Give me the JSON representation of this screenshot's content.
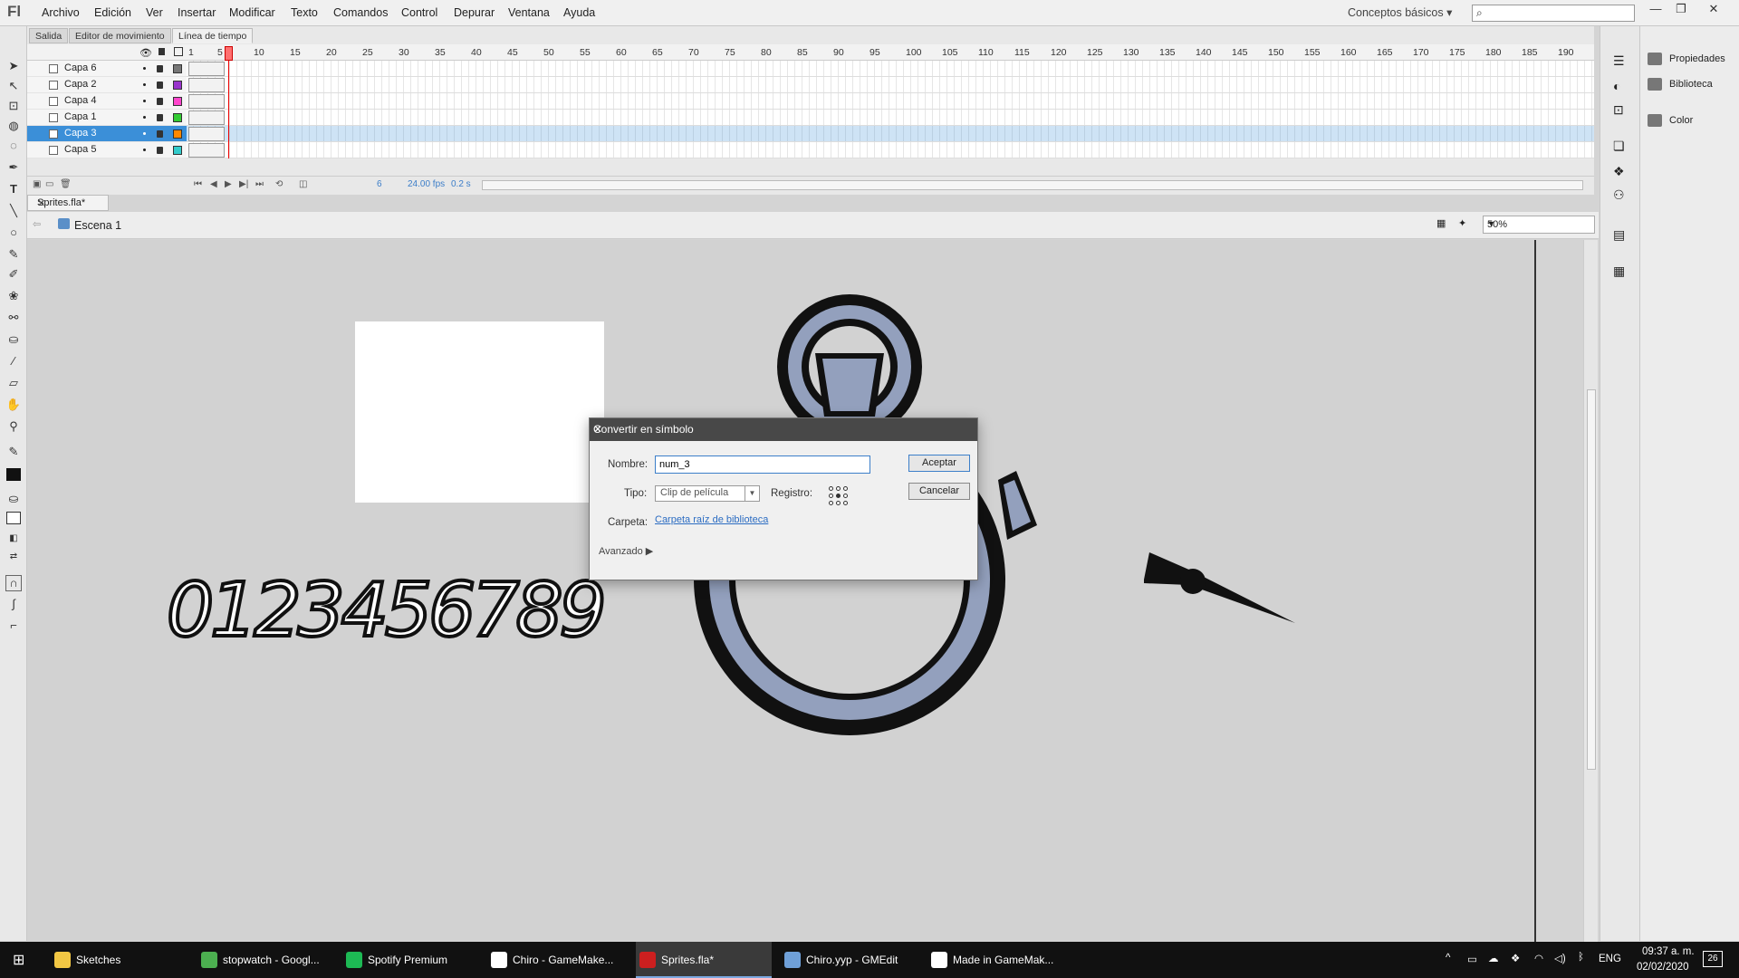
{
  "menubar": {
    "items": [
      "Archivo",
      "Edición",
      "Ver",
      "Insertar",
      "Modificar",
      "Texto",
      "Comandos",
      "Control",
      "Depurar",
      "Ventana",
      "Ayuda"
    ],
    "workspace": "Conceptos básicos",
    "search_placeholder": ""
  },
  "timeline": {
    "tabs": [
      "Salida",
      "Editor de movimiento",
      "Línea de tiempo"
    ],
    "active_tab": "Línea de tiempo",
    "frame_numbers": [
      "1",
      "5",
      "10",
      "15",
      "20",
      "25",
      "30",
      "35",
      "40",
      "45",
      "50",
      "55",
      "60",
      "65",
      "70",
      "75",
      "80",
      "85",
      "90",
      "95",
      "100",
      "105",
      "110",
      "115",
      "120",
      "125",
      "130",
      "135",
      "140",
      "145",
      "150",
      "155",
      "160",
      "165",
      "170",
      "175",
      "180",
      "185",
      "190"
    ],
    "layers": [
      {
        "name": "Capa 6",
        "color": "#777777",
        "selected": false
      },
      {
        "name": "Capa 2",
        "color": "#9933cc",
        "selected": false
      },
      {
        "name": "Capa 4",
        "color": "#ff44cc",
        "selected": false
      },
      {
        "name": "Capa 1",
        "color": "#33cc33",
        "selected": false
      },
      {
        "name": "Capa 3",
        "color": "#ff8800",
        "selected": true
      },
      {
        "name": "Capa 5",
        "color": "#33cccc",
        "selected": false
      }
    ],
    "current_frame": "6",
    "fps": "24.00 fps",
    "time": "0.2 s"
  },
  "document": {
    "tab_label": "Sprites.fla*",
    "scene_label": "Escena 1",
    "zoom": "50%"
  },
  "stage": {
    "digits_text": "0123456789"
  },
  "panels": {
    "items": [
      "Propiedades",
      "Biblioteca",
      "Color"
    ]
  },
  "dialog": {
    "title": "Convertir en símbolo",
    "name_label": "Nombre:",
    "name_value": "num_3",
    "type_label": "Tipo:",
    "type_value": "Clip de película",
    "registration_label": "Registro:",
    "folder_label": "Carpeta:",
    "folder_value": "Carpeta raíz de biblioteca",
    "advanced_label": "Avanzado",
    "accept_label": "Aceptar",
    "cancel_label": "Cancelar"
  },
  "taskbar": {
    "items": [
      {
        "label": "Sketches",
        "color": "#f2c744"
      },
      {
        "label": "stopwatch - Googl...",
        "color": "#4caf50"
      },
      {
        "label": "Spotify Premium",
        "color": "#1db954"
      },
      {
        "label": "Chiro - GameMake...",
        "color": "#ffffff"
      },
      {
        "label": "Sprites.fla*",
        "color": "#cc1f1f"
      },
      {
        "label": "Chiro.yyp - GMEdit",
        "color": "#6fa0d8"
      },
      {
        "label": "Made in GameMak...",
        "color": "#ffffff"
      }
    ],
    "language": "ENG",
    "time": "09:37 a. m.",
    "date": "02/02/2020",
    "notifications": "26"
  }
}
